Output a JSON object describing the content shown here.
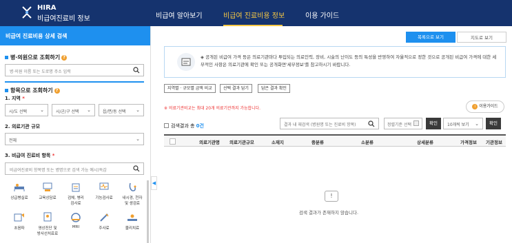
{
  "header": {
    "logo_top": "HIRA",
    "logo_bottom": "비급여진료비 정보",
    "nav": [
      "비급여 알아보기",
      "비급여 진료비용 정보",
      "이용 가이드"
    ]
  },
  "sidebar": {
    "title": "비급여 진료비용 상세 검색",
    "hospital_section": "병·의원으로 조회하기",
    "hospital_placeholder": "병·의원 이름 또는 도로명 주소 입력",
    "item_section": "항목으로 조회하기",
    "region_label": "1. 지역",
    "region_selects": [
      "시/도 선택",
      "시/군/구 선택",
      "읍/면/동 선택"
    ],
    "inst_label": "2. 의료기관 규모",
    "inst_value": "전체",
    "item_label": "3. 비급여 진료비 항목",
    "item_placeholder": "비급여진료비 항목명 또는 병명으로 검색 가능 예시)독감",
    "categories": [
      {
        "name": "상급병실료",
        "icon": "bed-icon"
      },
      {
        "name": "교육상담료",
        "icon": "counsel-icon"
      },
      {
        "name": "검체, 병리\n검사료",
        "icon": "lab-icon"
      },
      {
        "name": "기능검사료",
        "icon": "monitor-icon"
      },
      {
        "name": "내시경, 천자\n및 생검료",
        "icon": "endoscope-icon"
      },
      {
        "name": "초음파",
        "icon": "ultrasound-icon"
      },
      {
        "name": "영상진단 및\n방사선치료료",
        "icon": "xray-icon"
      },
      {
        "name": "MRI",
        "icon": "mri-icon"
      },
      {
        "name": "주사료",
        "icon": "syringe-icon"
      },
      {
        "name": "물리치료",
        "icon": "therapy-icon"
      }
    ]
  },
  "main": {
    "view_list": "목록으로 보기",
    "view_map": "지도로 보기",
    "notice": "◈ 공개된 비급여 가격 등은 의료기관마다 투입되는 의료인력, 장비, 시술의 난이도 등의 특성을 반영하여 자율적으로 정한 것으로 공개된 비급여 가격에 대한 세부적인 사항은 의료기관에 확인 또는 공개화면'세부정보'를 참고하시기 바랍니다.",
    "small_buttons": [
      "지역별 · 규모별 금액 비교",
      "선택 결과 담기",
      "담은 결과 확인"
    ],
    "warning": "※ 의료기관비교는 최대 20개 의료기관까지 가능합니다.",
    "guide": "이용가이드",
    "result_prefix": "검색결과 총",
    "result_count": "0건",
    "result_search_placeholder": "결과 내 재검색 (병원명 또는 진료비 항목)",
    "date_select": "정렬기준 선택",
    "confirm": "확인",
    "per_page": "10개씩 보기",
    "columns": [
      "의료기관명",
      "의료기관규모",
      "소재지",
      "중분류",
      "소분류",
      "상세분류",
      "가격정보",
      "기관정보"
    ],
    "empty_icon": "!",
    "empty_message": "검색 결과가 존재하지 않습니다."
  },
  "colors": {
    "header_bg": "#15336e",
    "accent": "#1e90ef",
    "active_nav": "#f7c844"
  }
}
